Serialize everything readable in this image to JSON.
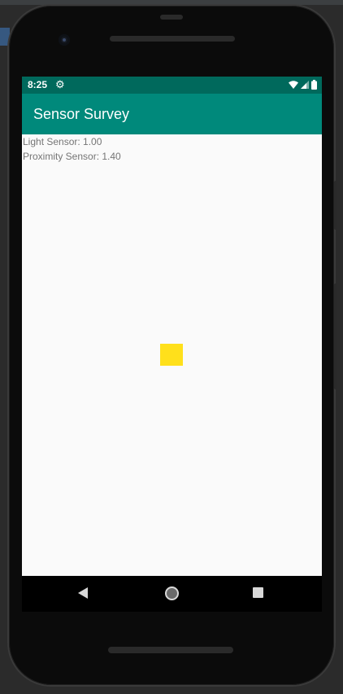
{
  "status_bar": {
    "time": "8:25",
    "icons": [
      "settings-icon",
      "wifi-icon",
      "signal-icon",
      "battery-icon"
    ]
  },
  "app_bar": {
    "title": "Sensor Survey",
    "color": "#00897b",
    "status_color": "#00695c"
  },
  "content": {
    "light_sensor": "Light Sensor: 1.00",
    "proximity_sensor": "Proximity Sensor: 1.40",
    "indicator_color": "#ffe01b"
  },
  "nav_bar": {
    "buttons": [
      "back-icon",
      "home-icon",
      "recents-icon"
    ]
  }
}
